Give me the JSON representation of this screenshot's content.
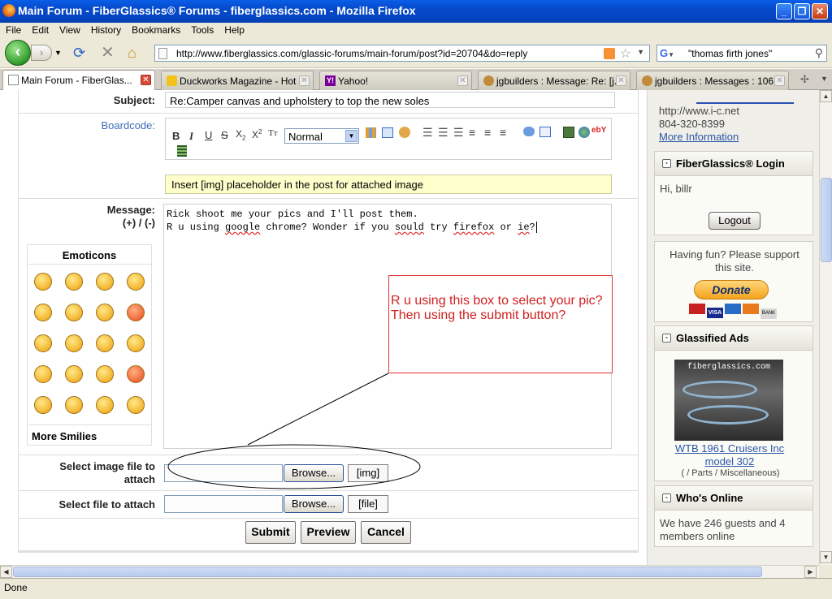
{
  "window": {
    "title": "Main Forum - FiberGlassics® Forums - fiberglassics.com - Mozilla Firefox"
  },
  "menu": [
    "File",
    "Edit",
    "View",
    "History",
    "Bookmarks",
    "Tools",
    "Help"
  ],
  "nav": {
    "url": "http://www.fiberglassics.com/glassic-forums/main-forum/post?id=20704&do=reply",
    "search": "\"thomas firth jones\""
  },
  "tabs": [
    {
      "label": "Main Forum - FiberGlas..."
    },
    {
      "label": "Duckworks Magazine - Hot ..."
    },
    {
      "label": "Yahoo!"
    },
    {
      "label": "jgbuilders : Message: Re: [j..."
    },
    {
      "label": "jgbuilders : Messages : 106..."
    }
  ],
  "form": {
    "subject_label": "Subject:",
    "subject_value": "Re:Camper canvas and upholstery to top the new soles",
    "boardcode_label": "Boardcode:",
    "format_select": "Normal",
    "img_note": "Insert [img] placeholder in the post for attached image",
    "message_label": "Message:",
    "message_sizer": "(+) / (-)",
    "message_lines": [
      "Rick shoot me your pics and I'll post them.",
      [
        "R u using ",
        "google",
        " chrome? Wonder if you ",
        "sould",
        " try ",
        "firefox",
        " or ",
        "ie",
        "?"
      ]
    ],
    "emoticons_title": "Emoticons",
    "more_smilies": "More Smilies",
    "annotation": "R u using this box to select your pic? Then using the submit button?",
    "image_file_label": "Select image file to attach",
    "file_label": "Select file to attach",
    "browse_label": "Browse...",
    "img_tag": "[img]",
    "file_tag": "[file]",
    "submit": "Submit",
    "preview": "Preview",
    "cancel": "Cancel"
  },
  "sidebar": {
    "link_url": "http://www.i-c.net",
    "phone": "804-320-8399",
    "more_info": "More Information",
    "login_title": "FiberGlassics® Login",
    "greeting": "Hi, billr",
    "logout": "Logout",
    "support_text": "Having fun? Please support this site.",
    "donate": "Donate",
    "payment_cards": [
      "",
      "VISA",
      "",
      "",
      "BANK"
    ],
    "ads_title": "Glassified Ads",
    "ad_image_caption": "fiberglassics.com",
    "ad_title": "WTB 1961 Cruisers Inc model 302",
    "ad_category": "( / Parts / Miscellaneous)",
    "whos_online_title": "Who's Online",
    "whos_online_text": "We have 246 guests and 4 members online"
  },
  "status": {
    "text": "Done"
  }
}
